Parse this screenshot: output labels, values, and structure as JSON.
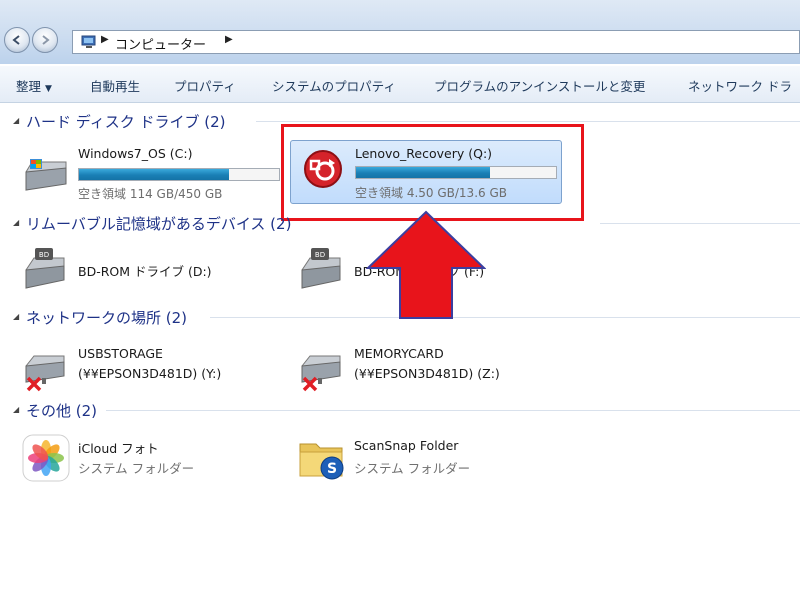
{
  "address": {
    "path_label": "コンピューター"
  },
  "toolbar": {
    "organize": "整理",
    "autoplay": "自動再生",
    "properties": "プロパティ",
    "system_properties": "システムのプロパティ",
    "uninstall": "プログラムのアンインストールと変更",
    "network_drive": "ネットワーク ドラ"
  },
  "groups": {
    "hdd": {
      "title": "ハード ディスク ドライブ (2)",
      "items": [
        {
          "name": "Windows7_OS (C:)",
          "free": "空き領域 114 GB/450 GB",
          "used_fraction": 0.75
        },
        {
          "name": "Lenovo_Recovery (Q:)",
          "free": "空き領域 4.50 GB/13.6 GB",
          "used_fraction": 0.67
        }
      ]
    },
    "removable": {
      "title": "リムーバブル記憶域があるデバイス (2)",
      "items": [
        {
          "name": "BD-ROM ドライブ (D:)"
        },
        {
          "name": "BD-ROM ドライブ (F:)"
        }
      ]
    },
    "network": {
      "title": "ネットワークの場所 (2)",
      "items": [
        {
          "name": "USBSTORAGE",
          "sub": "(¥¥EPSON3D481D) (Y:)"
        },
        {
          "name": "MEMORYCARD",
          "sub": "(¥¥EPSON3D481D) (Z:)"
        }
      ]
    },
    "other": {
      "title": "その他 (2)",
      "items": [
        {
          "name": "iCloud フォト",
          "sub": "システム フォルダー"
        },
        {
          "name": "ScanSnap Folder",
          "sub": "システム フォルダー"
        }
      ]
    }
  },
  "colors": {
    "annotation_red": "#e8141b",
    "capacity_bar": "#1a7fb5",
    "group_header": "#1e3287"
  },
  "icons": [
    "back-icon",
    "forward-icon",
    "computer-icon",
    "hard-drive-icon",
    "recovery-drive-icon",
    "bd-rom-icon",
    "network-drive-disconnected-icon",
    "photos-icon",
    "scansnap-folder-icon",
    "up-arrow-annotation"
  ]
}
